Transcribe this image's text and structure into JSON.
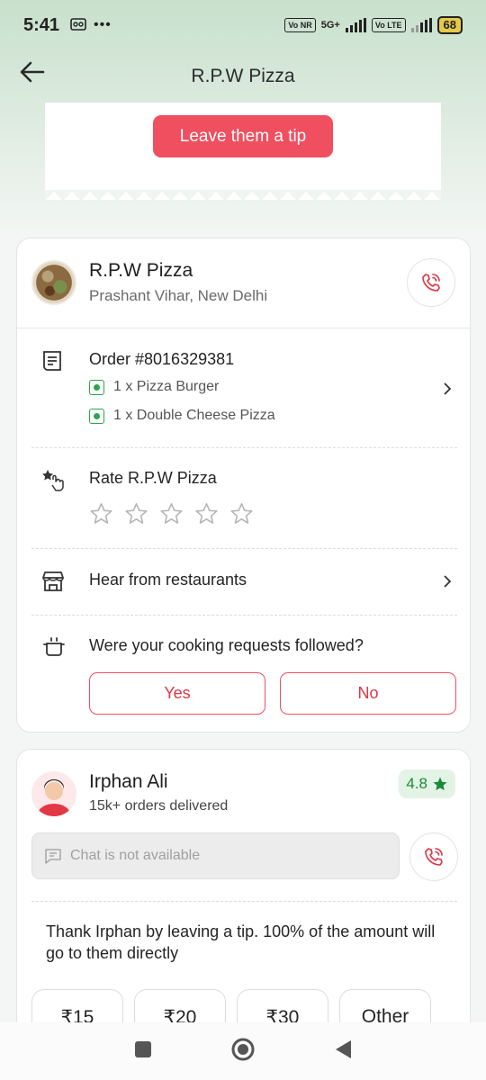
{
  "status_bar": {
    "time": "5:41",
    "dots": "•••",
    "net1": "Vo NR",
    "net2": "5G+",
    "net3": "Vo LTE",
    "battery": "68"
  },
  "header": {
    "title": "R.P.W Pizza"
  },
  "tip_banner": {
    "button_label": "Leave them a tip"
  },
  "restaurant": {
    "name": "R.P.W Pizza",
    "location": "Prashant Vihar, New Delhi",
    "order": {
      "label": "Order #8016329381",
      "items": [
        "1 x Pizza Burger",
        "1 x Double Cheese Pizza"
      ]
    },
    "rate_label": "Rate R.P.W Pizza",
    "star_count": 5,
    "hear_label": "Hear from restaurants",
    "cooking_question": "Were your cooking requests followed?",
    "yes_label": "Yes",
    "no_label": "No"
  },
  "rider": {
    "name": "Irphan Ali",
    "orders": "15k+ orders delivered",
    "rating": "4.8",
    "chat_placeholder": "Chat is not available",
    "thank_text": "Thank Irphan by leaving a tip. 100% of the amount will go to them directly",
    "tip_options": [
      "₹15",
      "₹20",
      "₹30",
      "Other"
    ]
  },
  "colors": {
    "accent": "#ef4f5f",
    "header_bg": "#c8e0cc",
    "rating_green": "#1b8a3a"
  }
}
